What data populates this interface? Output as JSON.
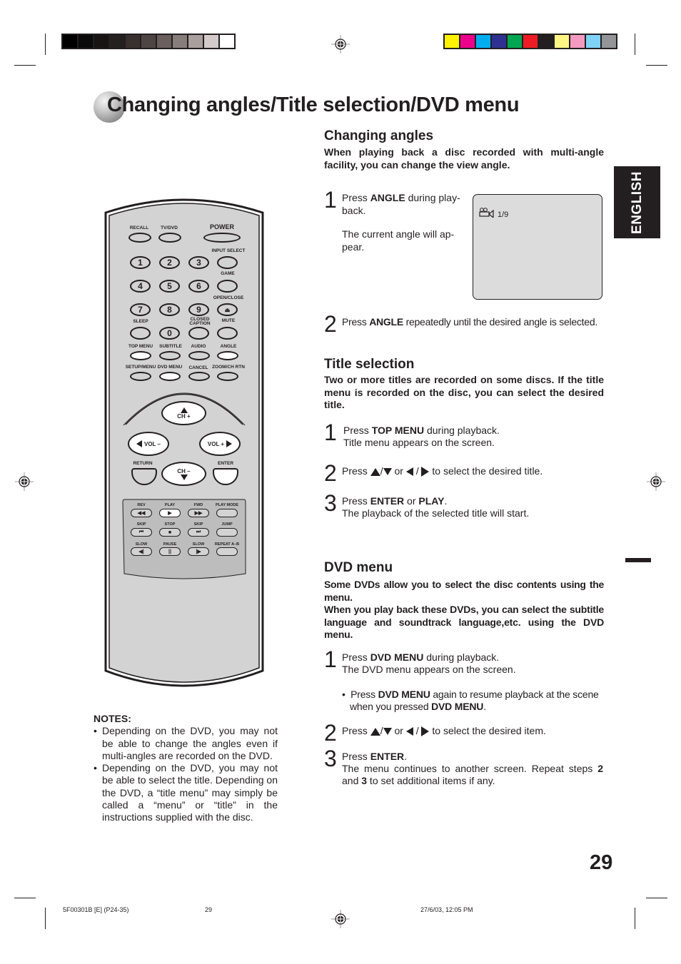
{
  "print_marks": {
    "gray_swatches": [
      "#000000",
      "#0b0a0a",
      "#171413",
      "#24201f",
      "#37302d",
      "#4d4543",
      "#6a5f5c",
      "#877e7b",
      "#a9a09d",
      "#d2cbc9",
      "#ffffff"
    ],
    "color_swatches": [
      "#fff200",
      "#ec008c",
      "#00aeef",
      "#2e3192",
      "#00a651",
      "#ed1c24",
      "#231f20",
      "#fff685",
      "#f49ac1",
      "#7fd3f7",
      "#939598"
    ]
  },
  "page": {
    "title": "Changing angles/Title selection/DVD menu",
    "language_tab": "ENGLISH",
    "page_number": "29"
  },
  "remote": {
    "top_row": [
      {
        "label": "RECALL",
        "caption": ""
      },
      {
        "label": "TV/DVD",
        "caption": ""
      },
      {
        "label": "POWER",
        "caption": ""
      }
    ],
    "side_labels": [
      "INPUT SELECT",
      "GAME",
      "OPEN/CLOSE",
      "MUTE"
    ],
    "numbers": [
      "1",
      "2",
      "3",
      "4",
      "5",
      "6",
      "7",
      "8",
      "9",
      "0"
    ],
    "sleep_label": "SLEEP",
    "closed_caption_label": "CLOSED CAPTION",
    "row_menu": [
      "TOP MENU",
      "SUBTITLE",
      "AUDIO",
      "ANGLE"
    ],
    "row_setup": [
      "SETUP/MENU",
      "DVD MENU",
      "CANCEL",
      "ZOOM/CH RTN"
    ],
    "nav": {
      "ch_up": "CH +",
      "ch_down": "CH –",
      "vol_down": "VOL –",
      "vol_up": "VOL +",
      "return": "RETURN",
      "enter": "ENTER"
    },
    "transport": {
      "row1": [
        "REV",
        "PLAY",
        "FWD",
        "PLAY MODE"
      ],
      "row2": [
        "SKIP",
        "STOP",
        "SKIP",
        "JUMP"
      ],
      "row3": [
        "SLOW",
        "PAUSE",
        "SLOW",
        "REPEAT A–B"
      ]
    }
  },
  "changing_angles": {
    "heading": "Changing angles",
    "lead": "When playing back a disc recorded with multi-angle facility, you can change the view angle.",
    "step1": {
      "num": "1",
      "pre": "Press ",
      "bold": "ANGLE",
      "post": " during play-",
      "line2": "back.",
      "line3": "The current angle will ap-",
      "line4": "pear."
    },
    "step2": {
      "num": "2",
      "pre": "Press ",
      "bold": "ANGLE",
      "post": " repeatedly until the desired angle is selected."
    },
    "osd": {
      "angle_value": "1/9"
    }
  },
  "title_selection": {
    "heading": "Title selection",
    "lead": "Two or more titles are recorded on some discs. If the title menu is recorded on the disc, you can select the desired title.",
    "step1": {
      "num": "1",
      "pre": "Press ",
      "bold": "TOP MENU",
      "post": " during playback.",
      "line2": "Title menu appears on the screen."
    },
    "step2": {
      "num": "2",
      "pre": "Press ",
      "mid": " or ",
      "post": " to select the desired title."
    },
    "step3": {
      "num": "3",
      "pre": "Press ",
      "bold1": "ENTER",
      "mid": " or ",
      "bold2": "PLAY",
      "post": ".",
      "line2": "The playback of the selected title will start."
    }
  },
  "dvd_menu": {
    "heading": "DVD menu",
    "lead1": "Some DVDs allow you to select the disc contents using the menu.",
    "lead2": "When you play back these DVDs, you can select the subtitle language and soundtrack language,etc. using the DVD menu.",
    "step1": {
      "num": "1",
      "pre": "Press ",
      "bold": "DVD MENU",
      "post": " during playback.",
      "line2": "The DVD menu appears on the screen."
    },
    "bullet": {
      "pre": "Press ",
      "bold1": "DVD MENU",
      "mid": " again to resume playback at the scene",
      "line2_pre": "when you pressed ",
      "bold2": "DVD MENU",
      "line2_post": "."
    },
    "step2": {
      "num": "2",
      "pre": "Press ",
      "mid": " or ",
      "post": " to select the desired item."
    },
    "step3": {
      "num": "3",
      "pre": "Press ",
      "bold": "ENTER",
      "post": ".",
      "line2_pre": "The menu continues to another screen. Repeat steps ",
      "b2": "2",
      "line3_pre": "and ",
      "b3": "3",
      "line3_post": " to set additional items if any."
    }
  },
  "notes": {
    "heading": "NOTES:",
    "items": [
      "Depending on the DVD, you may not be able to change the angles even if multi-angles are recorded on the DVD.",
      "Depending on the DVD, you may not be able to select the title. Depending on the DVD, a “title menu” may simply be called a “menu” or “title” in the instructions supplied with the disc."
    ]
  },
  "footer": {
    "file_code": "5F00301B [E] (P24-35)",
    "page": "29",
    "timestamp": "27/6/03, 12:05 PM"
  }
}
